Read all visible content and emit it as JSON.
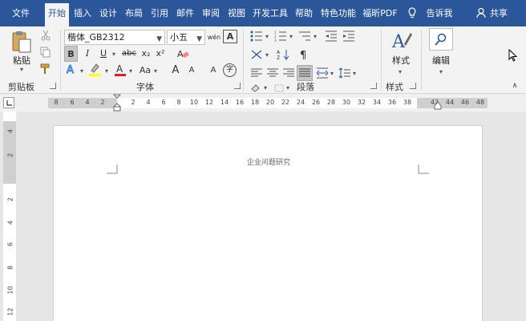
{
  "tabs": [
    "文件",
    "开始",
    "插入",
    "设计",
    "布局",
    "引用",
    "邮件",
    "审阅",
    "视图",
    "开发工具",
    "帮助",
    "特色功能",
    "福昕PDF"
  ],
  "tell_me": "告诉我",
  "share": "共享",
  "clipboard": {
    "paste_label": "粘贴",
    "group_label": "剪贴板"
  },
  "font": {
    "family": "楷体_GB2312",
    "size": "小五",
    "bold": "B",
    "italic": "I",
    "underline": "U",
    "strikethrough": "abc",
    "subscript": "x₂",
    "superscript": "x²",
    "grow": "A",
    "shrink": "A",
    "case": "Aa",
    "phonetic": "wén",
    "char_border": "A",
    "enclose": "字",
    "group_label": "字体"
  },
  "paragraph": {
    "group_label": "段落"
  },
  "styles": {
    "label": "样式",
    "group_label": "样式"
  },
  "editing": {
    "label": "编辑"
  },
  "ruler": {
    "h_numbers": [
      "8",
      "6",
      "4",
      "2",
      "2",
      "4",
      "6",
      "8",
      "10",
      "12",
      "14",
      "16",
      "18",
      "20",
      "22",
      "24",
      "26",
      "28",
      "30",
      "32",
      "34",
      "36",
      "38",
      "42",
      "44",
      "46",
      "48"
    ],
    "v_numbers": [
      "4",
      "2",
      "2",
      "4",
      "6",
      "8",
      "10",
      "12"
    ]
  },
  "document": {
    "header_text": "企业问题研究"
  },
  "colors": {
    "accent": "#2b579a",
    "highlight": "#ffff00",
    "font_color": "#e02020"
  }
}
